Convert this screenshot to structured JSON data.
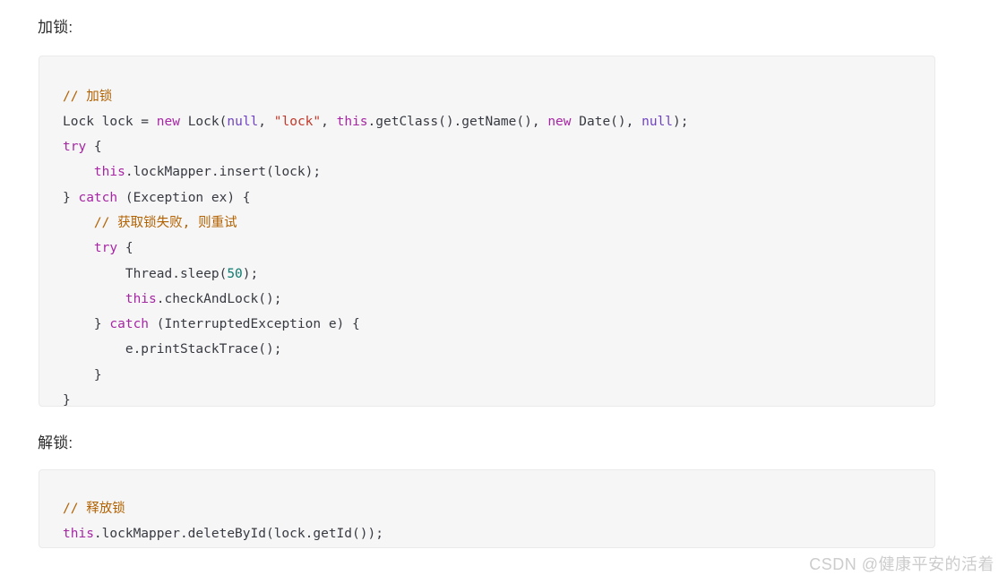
{
  "sections": {
    "lock": {
      "label": "加锁:",
      "code_lines": [
        [
          {
            "t": "// 加锁",
            "c": "comment"
          }
        ],
        [
          {
            "t": "Lock lock = ",
            "c": "plain"
          },
          {
            "t": "new",
            "c": "keyword"
          },
          {
            "t": " Lock(",
            "c": "plain"
          },
          {
            "t": "null",
            "c": "const"
          },
          {
            "t": ", ",
            "c": "plain"
          },
          {
            "t": "\"lock\"",
            "c": "string"
          },
          {
            "t": ", ",
            "c": "plain"
          },
          {
            "t": "this",
            "c": "keyword"
          },
          {
            "t": ".getClass().getName(), ",
            "c": "plain"
          },
          {
            "t": "new",
            "c": "keyword"
          },
          {
            "t": " Date(), ",
            "c": "plain"
          },
          {
            "t": "null",
            "c": "const"
          },
          {
            "t": ");",
            "c": "plain"
          }
        ],
        [
          {
            "t": "try",
            "c": "keyword"
          },
          {
            "t": " {",
            "c": "plain"
          }
        ],
        [
          {
            "t": "    ",
            "c": "plain"
          },
          {
            "t": "this",
            "c": "keyword"
          },
          {
            "t": ".lockMapper.insert(lock);",
            "c": "plain"
          }
        ],
        [
          {
            "t": "} ",
            "c": "plain"
          },
          {
            "t": "catch",
            "c": "keyword"
          },
          {
            "t": " (Exception ex) {",
            "c": "plain"
          }
        ],
        [
          {
            "t": "    ",
            "c": "plain"
          },
          {
            "t": "// 获取锁失败, 则重试",
            "c": "comment"
          }
        ],
        [
          {
            "t": "    ",
            "c": "plain"
          },
          {
            "t": "try",
            "c": "keyword"
          },
          {
            "t": " {",
            "c": "plain"
          }
        ],
        [
          {
            "t": "        Thread.sleep(",
            "c": "plain"
          },
          {
            "t": "50",
            "c": "number"
          },
          {
            "t": ");",
            "c": "plain"
          }
        ],
        [
          {
            "t": "        ",
            "c": "plain"
          },
          {
            "t": "this",
            "c": "keyword"
          },
          {
            "t": ".checkAndLock();",
            "c": "plain"
          }
        ],
        [
          {
            "t": "    } ",
            "c": "plain"
          },
          {
            "t": "catch",
            "c": "keyword"
          },
          {
            "t": " (InterruptedException e) {",
            "c": "plain"
          }
        ],
        [
          {
            "t": "        e.printStackTrace();",
            "c": "plain"
          }
        ],
        [
          {
            "t": "    }",
            "c": "plain"
          }
        ],
        [
          {
            "t": "}",
            "c": "plain"
          }
        ]
      ]
    },
    "unlock": {
      "label": "解锁:",
      "code_lines": [
        [
          {
            "t": "// 释放锁",
            "c": "comment"
          }
        ],
        [
          {
            "t": "this",
            "c": "keyword"
          },
          {
            "t": ".lockMapper.deleteById(lock.getId());",
            "c": "plain"
          }
        ]
      ]
    }
  },
  "watermark": {
    "text": "CSDN @健康平安的活着"
  },
  "colors": {
    "page_background": "#ffffff",
    "code_background": "#f6f6f6",
    "code_border": "#eaeaea",
    "text": "#383a42",
    "comment": "#b26100",
    "keyword": "#a626a4",
    "string": "#c0392b",
    "number": "#0c7a6e",
    "constant": "#6f42c1",
    "watermark": "#cccccc"
  }
}
